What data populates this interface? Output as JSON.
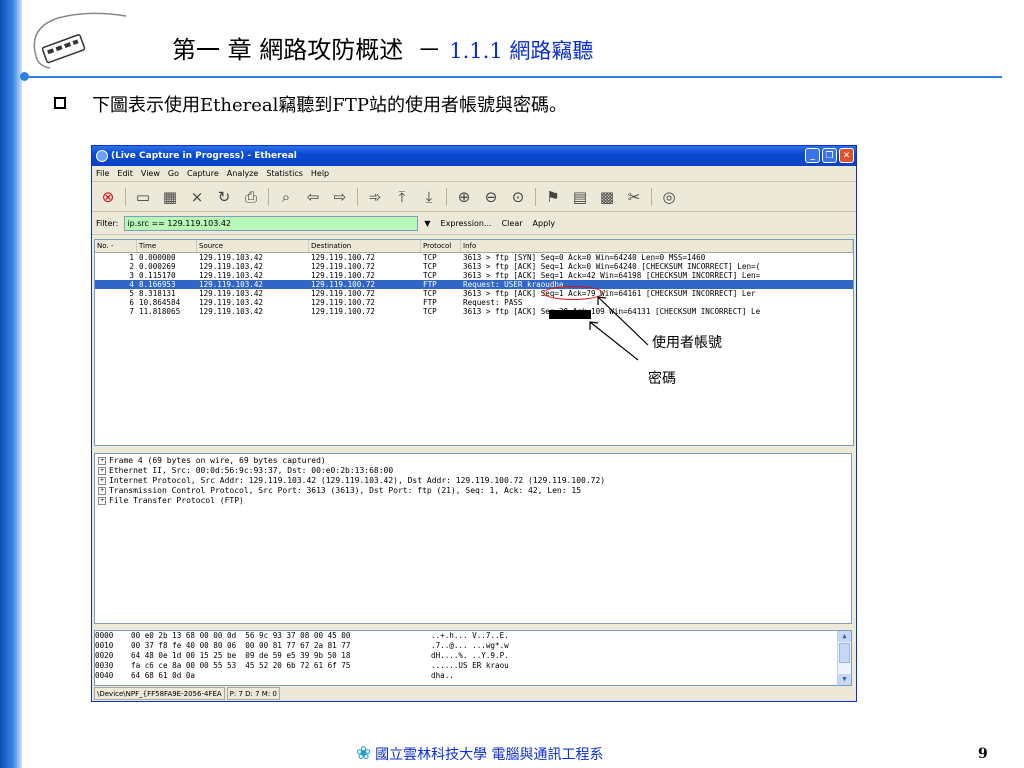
{
  "slide": {
    "title_main": "第一 章  網路攻防概述",
    "title_dash": "－",
    "title_sub": "1.1.1 網路竊聽",
    "bullet": "下圖表示使用Ethereal竊聽到FTP站的使用者帳號與密碼。",
    "annotation_user": "使用者帳號",
    "annotation_pass": "密碼",
    "footer_text": "國立雲林科技大學 電腦與通訊工程系",
    "page_number": "9"
  },
  "window": {
    "title": "(Live Capture in Progress) - Ethereal",
    "menu": [
      "File",
      "Edit",
      "View",
      "Go",
      "Capture",
      "Analyze",
      "Statistics",
      "Help"
    ],
    "toolbar_icons": [
      "stop-icon",
      "open-icon",
      "save-icon",
      "close-file-icon",
      "reload-icon",
      "print-icon",
      "find-icon",
      "back-icon",
      "forward-icon",
      "goto-icon",
      "first-icon",
      "last-icon",
      "zoom-in-icon",
      "zoom-out-icon",
      "zoom-normal-icon",
      "color-filter-icon",
      "display-filter-icon",
      "coloring-rules-icon",
      "preferences-icon",
      "help-icon"
    ],
    "filter_label": "Filter:",
    "filter_value": "ip.src == 129.119.103.42",
    "filter_buttons": [
      "Expression...",
      "Clear",
      "Apply"
    ]
  },
  "packet_list": {
    "columns": [
      "No. -",
      "Time",
      "Source",
      "Destination",
      "Protocol",
      "Info"
    ],
    "rows": [
      {
        "no": "1",
        "time": "0.000000",
        "src": "129.119.103.42",
        "dst": "129.119.100.72",
        "proto": "TCP",
        "info": "3613 > ftp [SYN] Seq=0 Ack=0 Win=64240 Len=0 MSS=1460"
      },
      {
        "no": "2",
        "time": "0.000269",
        "src": "129.119.103.42",
        "dst": "129.119.100.72",
        "proto": "TCP",
        "info": "3613 > ftp [ACK] Seq=1 Ack=0 Win=64240 [CHECKSUM INCORRECT] Len=("
      },
      {
        "no": "3",
        "time": "0.115170",
        "src": "129.119.103.42",
        "dst": "129.119.100.72",
        "proto": "TCP",
        "info": "3613 > ftp [ACK] Seq=1 Ack=42 Win=64198 [CHECKSUM INCORRECT] Len="
      },
      {
        "no": "4",
        "time": "8.166953",
        "src": "129.119.103.42",
        "dst": "129.119.100.72",
        "proto": "FTP",
        "info": "Request: USER kraoudha"
      },
      {
        "no": "5",
        "time": "8.318131",
        "src": "129.119.103.42",
        "dst": "129.119.100.72",
        "proto": "TCP",
        "info": "3613 > ftp [ACK] Seq=1 Ack=79 Win=64161 [CHECKSUM INCORRECT] Ler"
      },
      {
        "no": "6",
        "time": "10.864584",
        "src": "129.119.103.42",
        "dst": "129.119.100.72",
        "proto": "FTP",
        "info": "Request: PASS"
      },
      {
        "no": "7",
        "time": "11.818065",
        "src": "129.119.103.42",
        "dst": "129.119.100.72",
        "proto": "TCP",
        "info": "3613 > ftp [ACK] Seq=29 Ack=109 Win=64131 [CHECKSUM INCORRECT] Le"
      }
    ],
    "selected_row": 4
  },
  "details": [
    "Frame 4 (69 bytes on wire, 69 bytes captured)",
    "Ethernet II, Src: 00:0d:56:9c:93:37, Dst: 00:e0:2b:13:68:00",
    "Internet Protocol, Src Addr: 129.119.103.42 (129.119.103.42), Dst Addr: 129.119.100.72 (129.119.100.72)",
    "Transmission Control Protocol, Src Port: 3613 (3613), Dst Port: ftp (21), Seq: 1, Ack: 42, Len: 15",
    "File Transfer Protocol (FTP)"
  ],
  "hex": [
    {
      "off": "0000",
      "bytes": "00 e0 2b 13 68 00 00 0d  56 9c 93 37 08 00 45 00",
      "ascii": "..+.h... V..7..E."
    },
    {
      "off": "0010",
      "bytes": "00 37 f8 fe 40 00 80 06  00 00 81 77 67 2a 81 77",
      "ascii": ".7..@... ...wg*.w"
    },
    {
      "off": "0020",
      "bytes": "64 48 0e 1d 00 15 25 be  09 de 59 e5 39 9b 50 18",
      "ascii": "dH....%. ..Y.9.P."
    },
    {
      "off": "0030",
      "bytes": "fa c6 ce 8a 00 00 55 53  45 52 20 6b 72 61 6f 75",
      "ascii": "......US ER kraou"
    },
    {
      "off": "0040",
      "bytes": "64 68 61 0d 0a",
      "ascii": "dha.."
    }
  ],
  "status": {
    "device": "\\Device\\NPF_{FF58FA9E-2056-4FEA",
    "counts": "P: 7 D: 7 M: 0"
  }
}
